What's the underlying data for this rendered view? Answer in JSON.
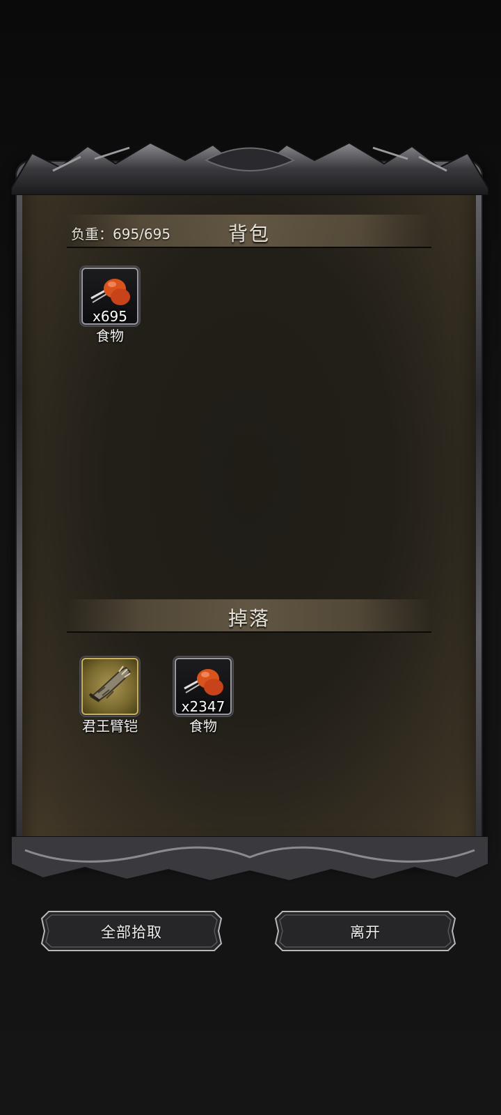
{
  "backpack": {
    "title": "背包",
    "weight_label": "负重：695/695",
    "items": [
      {
        "name": "食物",
        "quantity": "x695",
        "icon": "meat-icon"
      }
    ]
  },
  "drops": {
    "title": "掉落",
    "items": [
      {
        "name": "君王臂铠",
        "quantity": "",
        "icon": "gauntlet-icon"
      },
      {
        "name": "食物",
        "quantity": "x2347",
        "icon": "meat-icon"
      }
    ]
  },
  "buttons": {
    "pick_all": "全部拾取",
    "leave": "离开"
  },
  "colors": {
    "panel_bg": "#221f19",
    "header_band": "#7d6e55",
    "rare_slot": "#a89654"
  }
}
